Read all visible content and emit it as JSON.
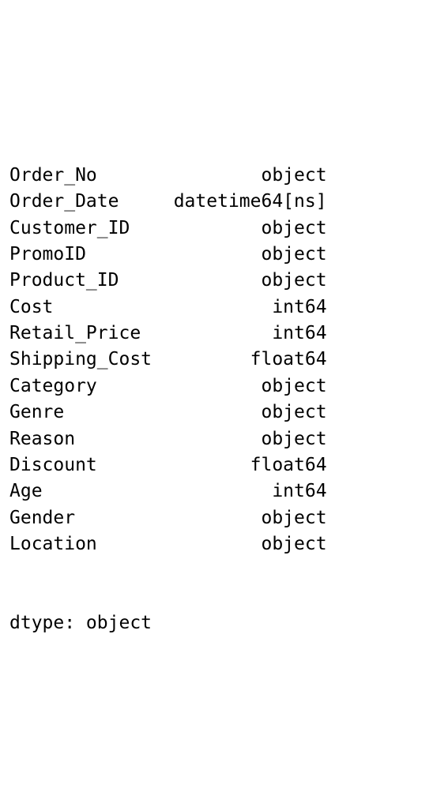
{
  "rows": [
    {
      "name": "Order_No",
      "dtype": "object"
    },
    {
      "name": "Order_Date",
      "dtype": "datetime64[ns]"
    },
    {
      "name": "Customer_ID",
      "dtype": "object"
    },
    {
      "name": "PromoID",
      "dtype": "object"
    },
    {
      "name": "Product_ID",
      "dtype": "object"
    },
    {
      "name": "Cost",
      "dtype": "int64"
    },
    {
      "name": "Retail_Price",
      "dtype": "int64"
    },
    {
      "name": "Shipping_Cost",
      "dtype": "float64"
    },
    {
      "name": "Category",
      "dtype": "object"
    },
    {
      "name": "Genre",
      "dtype": "object"
    },
    {
      "name": "Reason",
      "dtype": "object"
    },
    {
      "name": "Discount",
      "dtype": "float64"
    },
    {
      "name": "Age",
      "dtype": "int64"
    },
    {
      "name": "Gender",
      "dtype": "object"
    },
    {
      "name": "Location",
      "dtype": "object"
    }
  ],
  "footer": "dtype: object"
}
